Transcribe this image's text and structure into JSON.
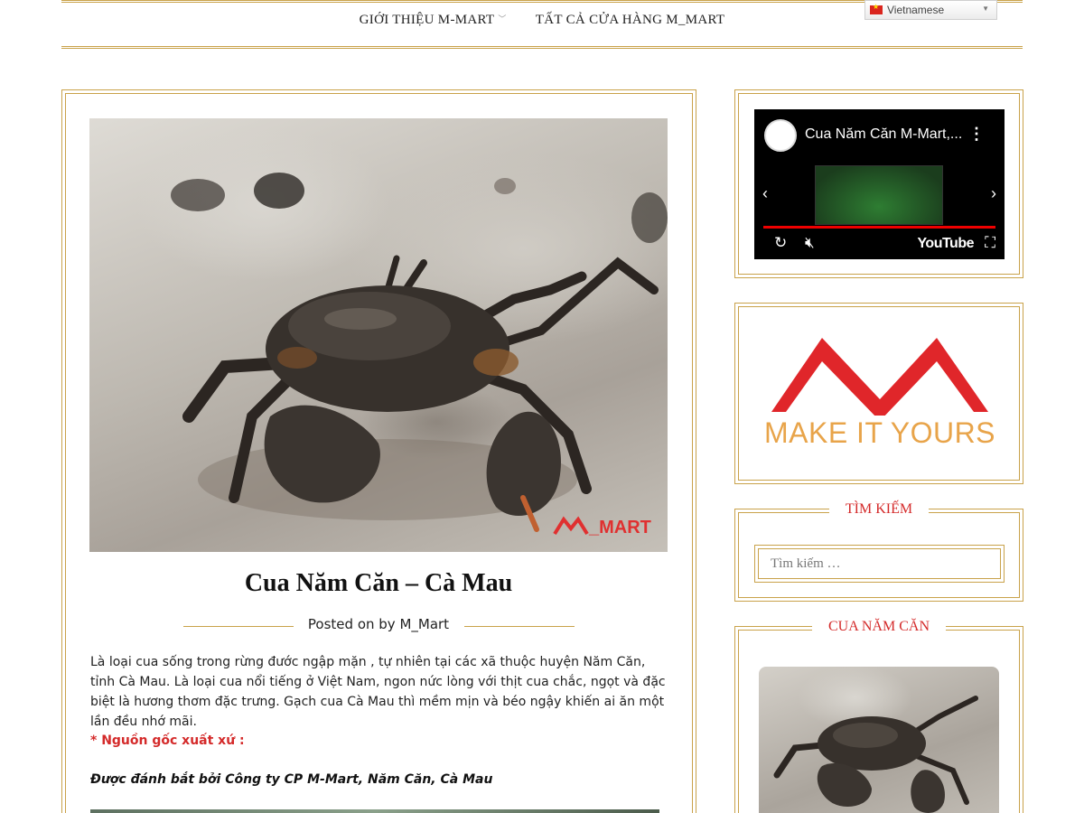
{
  "nav": {
    "items": [
      {
        "label": "GIỚI THIỆU M-MART",
        "has_dropdown": true
      },
      {
        "label": "TẤT CẢ CỬA HÀNG M_MART",
        "has_dropdown": false
      }
    ]
  },
  "language": {
    "selected": "Vietnamese"
  },
  "post": {
    "hero_watermark": "_MART",
    "title": "Cua Năm Căn – Cà Mau",
    "meta": "Posted on by M_Mart",
    "paragraph": "Là loại cua sống trong rừng đước ngập mặn , tự nhiên tại các xã thuộc huyện Năm Căn, tỉnh Cà Mau. Là loại cua nổi tiếng ở Việt Nam, ngon nức lòng với thịt cua chắc, ngọt và đặc biệt là hương thơm đặc trưng. Gạch cua Cà Mau thì mềm mịn và béo ngậy khiến ai ăn một lần đều nhớ mãi.",
    "origin_heading": "* Nguồn gốc xuất xứ :",
    "caught_by": "Được đánh bắt bởi Công ty CP M-Mart, Năm Căn, Cà Mau"
  },
  "sidebar": {
    "video": {
      "title": "Cua Năm Căn M-Mart,...",
      "platform": "YouTube"
    },
    "logo": {
      "tagline": "MAKE IT YOURS"
    },
    "search": {
      "heading": "TÌM KIẾM",
      "placeholder": "Tìm kiếm …"
    },
    "product": {
      "heading": "CUA NĂM CĂN"
    }
  },
  "colors": {
    "gold": "#c9a24a",
    "accent_red": "#d42a2a",
    "logo_red": "#e0262a",
    "logo_orange": "#e8a44a"
  }
}
